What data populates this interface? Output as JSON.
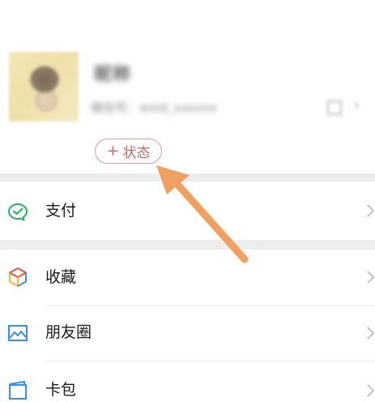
{
  "profile": {
    "nickname": "昵称",
    "wechat_id": "微信号：wxid_xxxxxx",
    "status_plus": "+",
    "status_label": "状态",
    "chevron": "›"
  },
  "menu": {
    "items": [
      {
        "label": "支付",
        "icon": "wechat-pay-icon"
      },
      {
        "label": "收藏",
        "icon": "favorites-cube-icon"
      },
      {
        "label": "朋友圈",
        "icon": "moments-photo-icon"
      },
      {
        "label": "卡包",
        "icon": "card-wallet-icon"
      }
    ]
  },
  "colors": {
    "pay_green": "#27ae60",
    "status_border": "#e29a9a",
    "annotation_arrow": "#f0a060",
    "section_gap": "#ededed"
  }
}
